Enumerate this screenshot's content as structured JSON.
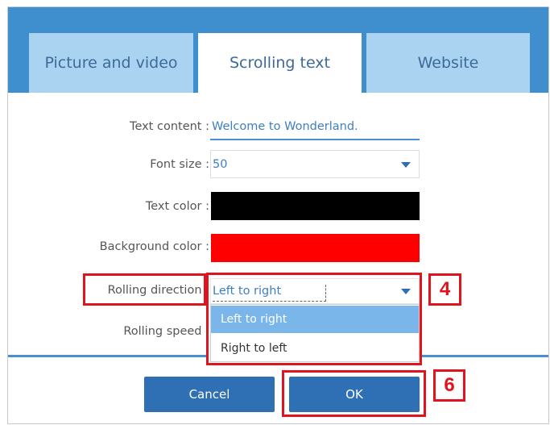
{
  "tabs": [
    {
      "label": "Picture and video",
      "active": false
    },
    {
      "label": "Scrolling text",
      "active": true
    },
    {
      "label": "Website",
      "active": false
    }
  ],
  "form": {
    "text_content_label": "Text content :",
    "text_content_value": "Welcome to Wonderland.",
    "font_size_label": "Font size :",
    "font_size_value": "50",
    "text_color_label": "Text color :",
    "text_color_value": "#000000",
    "background_color_label": "Background color :",
    "background_color_value": "#ff0000",
    "rolling_direction_label": "Rolling direction :",
    "rolling_direction_value": "Left to right",
    "rolling_direction_options": [
      "Left to right",
      "Right to left"
    ],
    "rolling_speed_label": "Rolling speed :"
  },
  "buttons": {
    "cancel": "Cancel",
    "ok": "OK"
  },
  "callouts": {
    "dropdown_step": "4",
    "ok_step": "6"
  },
  "colors": {
    "tab_bar": "#3f8fcf",
    "tab_inactive": "#a9d3f1",
    "accent": "#2f6fb3",
    "highlight": "#e0141f",
    "selected_option": "#7ab6ea"
  }
}
